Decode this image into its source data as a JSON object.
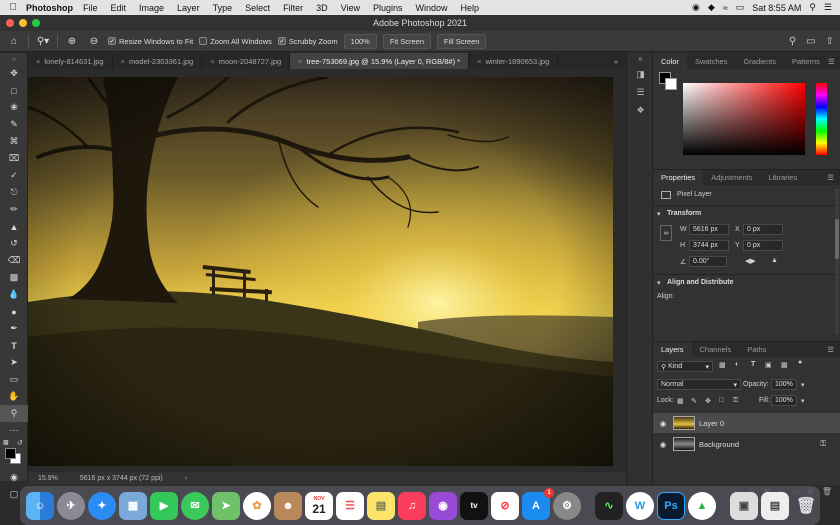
{
  "menubar": {
    "app_name": "Photoshop",
    "items": [
      "File",
      "Edit",
      "Image",
      "Layer",
      "Type",
      "Select",
      "Filter",
      "3D",
      "View",
      "Plugins",
      "Window",
      "Help"
    ],
    "clock": "Sat 8:55 AM"
  },
  "window": {
    "title": "Adobe Photoshop 2021"
  },
  "options": {
    "resize_windows": "Resize Windows to Fit",
    "zoom_all": "Zoom All Windows",
    "scrubby": "Scrubby Zoom",
    "zoom_value": "100%",
    "fit_screen": "Fit Screen",
    "fill_screen": "Fill Screen"
  },
  "tabs": [
    {
      "label": "lonely-814631.jpg"
    },
    {
      "label": "model-2303361.jpg"
    },
    {
      "label": "moon-2048727.jpg"
    },
    {
      "label": "tree-753069.jpg @ 15.9% (Layer 0, RGB/8#) *"
    },
    {
      "label": "winter-1890653.jpg"
    }
  ],
  "status": {
    "zoom": "15.9%",
    "doc": "5616 px x 3744 px (72 ppi)"
  },
  "color_panel": {
    "tabs": [
      "Color",
      "Swatches",
      "Gradients",
      "Patterns"
    ]
  },
  "properties": {
    "tabs": [
      "Properties",
      "Adjustments",
      "Libraries"
    ],
    "kind": "Pixel Layer",
    "transform_title": "Transform",
    "w_label": "W",
    "w_value": "5616 px",
    "h_label": "H",
    "h_value": "3744 px",
    "x_label": "X",
    "x_value": "0 px",
    "y_label": "Y",
    "y_value": "0 px",
    "angle": "0.00°",
    "align_title": "Align and Distribute",
    "align_label": "Align:"
  },
  "layers_panel": {
    "tabs": [
      "Layers",
      "Channels",
      "Paths"
    ],
    "filter_kind": "Kind",
    "blend_mode": "Normal",
    "opacity_label": "Opacity:",
    "opacity_value": "100%",
    "lock_label": "Lock:",
    "fill_label": "Fill:",
    "fill_value": "100%",
    "layers": [
      {
        "name": "Layer 0"
      },
      {
        "name": "Background"
      }
    ]
  },
  "dock": {
    "calendar_month": "NOV",
    "calendar_day": "21",
    "appstore_badge": "1",
    "photoshop_label": "Ps"
  }
}
